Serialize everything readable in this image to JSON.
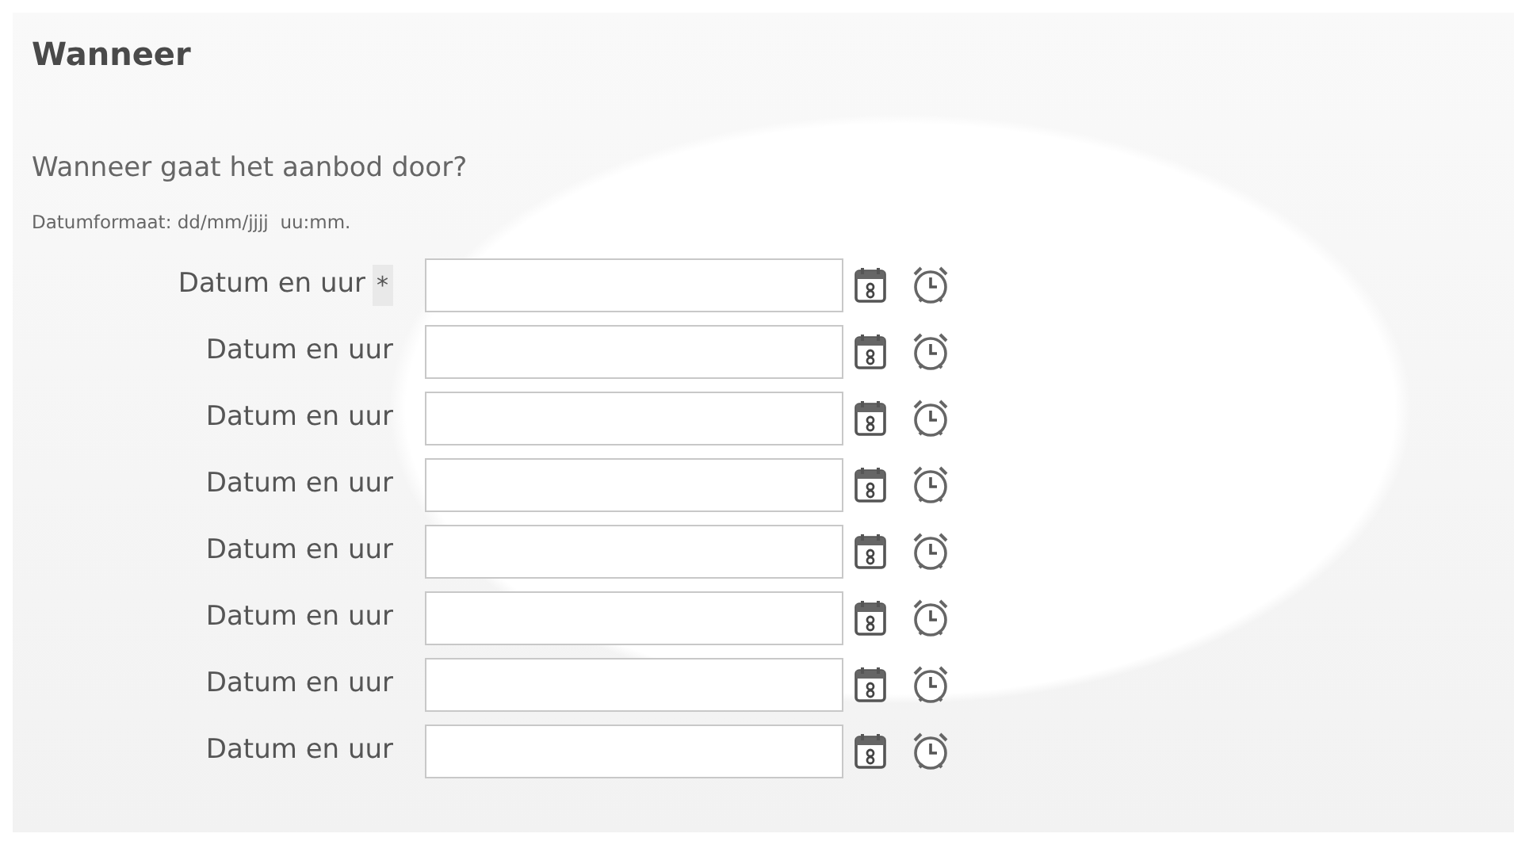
{
  "heading": "Wanneer",
  "question": "Wanneer gaat het aanbod door?",
  "format_hint": "Datumformaat: dd/mm/jjjj  uu:mm.",
  "rows": [
    {
      "label": "Datum en uur",
      "required_mark": "*"
    },
    {
      "label": "Datum en uur"
    },
    {
      "label": "Datum en uur"
    },
    {
      "label": "Datum en uur"
    },
    {
      "label": "Datum en uur"
    },
    {
      "label": "Datum en uur"
    },
    {
      "label": "Datum en uur"
    },
    {
      "label": "Datum en uur"
    }
  ]
}
